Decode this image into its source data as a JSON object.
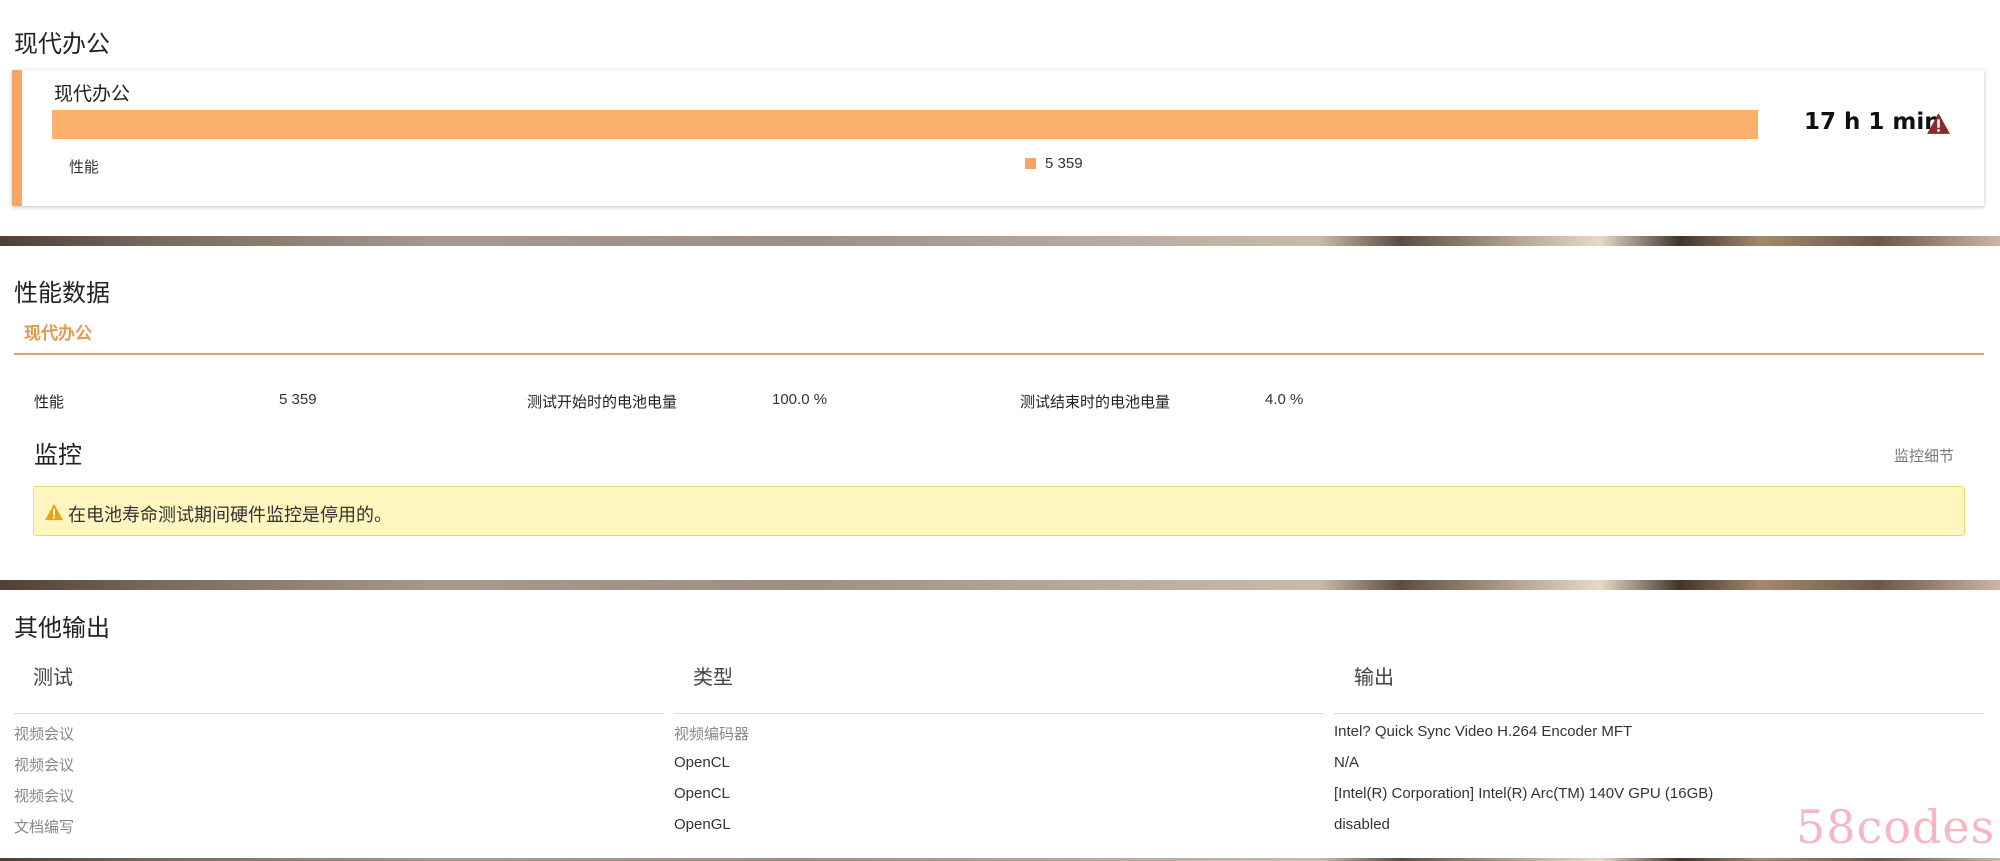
{
  "section_battery": {
    "title": "现代办公",
    "card": {
      "title": "现代办公",
      "progress_fraction": 1.0,
      "bar_color": "#fbb06e",
      "duration": "17 h 1 min",
      "warning_icon": "warning-triangle-icon",
      "performance_label": "性能",
      "legend_value": "5 359"
    }
  },
  "section_perf": {
    "title": "性能数据",
    "tab": "现代办公",
    "accent": "#e09a4e",
    "stats": [
      {
        "label": "性能",
        "value": "5 359"
      },
      {
        "label": "测试开始时的电池电量",
        "value": "100.0 %"
      },
      {
        "label": "测试结束时的电池电量",
        "value": "4.0 %"
      }
    ],
    "monitor": {
      "title": "监控",
      "details_link": "监控细节",
      "alert": "在电池寿命测试期间硬件监控是停用的。",
      "alert_icon": "warning-triangle-icon"
    }
  },
  "section_other": {
    "title": "其他输出",
    "columns": [
      "测试",
      "类型",
      "输出"
    ],
    "rows": [
      [
        "视频会议",
        "视频编码器",
        "Intel? Quick Sync Video H.264 Encoder MFT"
      ],
      [
        "视频会议",
        "OpenCL",
        "N/A"
      ],
      [
        "视频会议",
        "OpenCL",
        "[Intel(R) Corporation] Intel(R) Arc(TM) 140V GPU (16GB)"
      ],
      [
        "文档编写",
        "OpenGL",
        "disabled"
      ]
    ]
  },
  "watermark": "58codes"
}
